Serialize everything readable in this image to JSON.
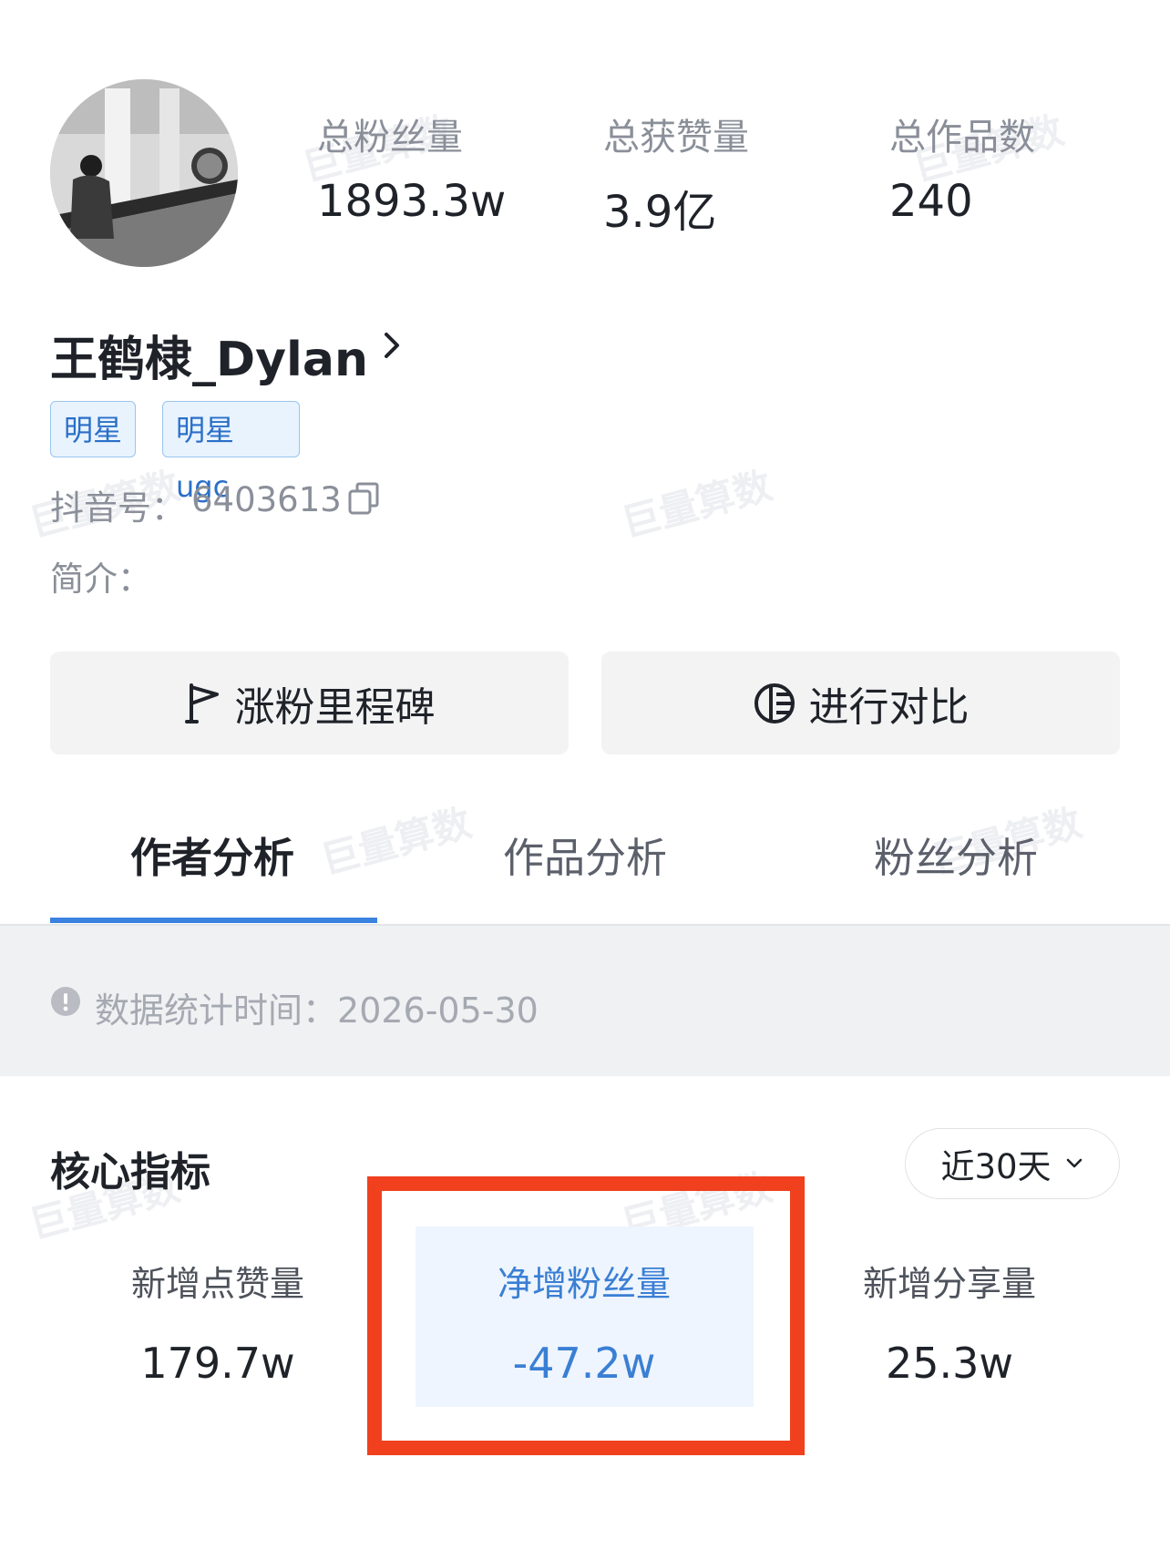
{
  "profile": {
    "stats": [
      {
        "label": "总粉丝量",
        "value": "1893.3w"
      },
      {
        "label": "总获赞量",
        "value": "3.9亿"
      },
      {
        "label": "总作品数",
        "value": "240"
      }
    ],
    "username": "王鹤棣_Dylan",
    "tags": [
      "明星",
      "明星ugc"
    ],
    "douyin_id_label": "抖音号：",
    "douyin_id": "6403613",
    "bio_label": "简介："
  },
  "actions": {
    "milestone_label": "涨粉里程碑",
    "compare_label": "进行对比"
  },
  "tabs": [
    {
      "label": "作者分析",
      "active": true
    },
    {
      "label": "作品分析",
      "active": false
    },
    {
      "label": "粉丝分析",
      "active": false
    }
  ],
  "info": {
    "stat_time_label": "数据统计时间：",
    "stat_time": "2026-05-30"
  },
  "core": {
    "title": "核心指标",
    "range": "近30天",
    "metrics": [
      {
        "label": "新增点赞量",
        "value": "179.7w"
      },
      {
        "label": "净增粉丝量",
        "value": "-47.2w"
      },
      {
        "label": "新增分享量",
        "value": "25.3w"
      }
    ]
  },
  "watermark": "巨量算数",
  "colors": {
    "accent": "#3b82e0",
    "highlight_border": "#f0401e",
    "tag_bg": "#e8f3fe",
    "tag_text": "#2b6fc8"
  }
}
